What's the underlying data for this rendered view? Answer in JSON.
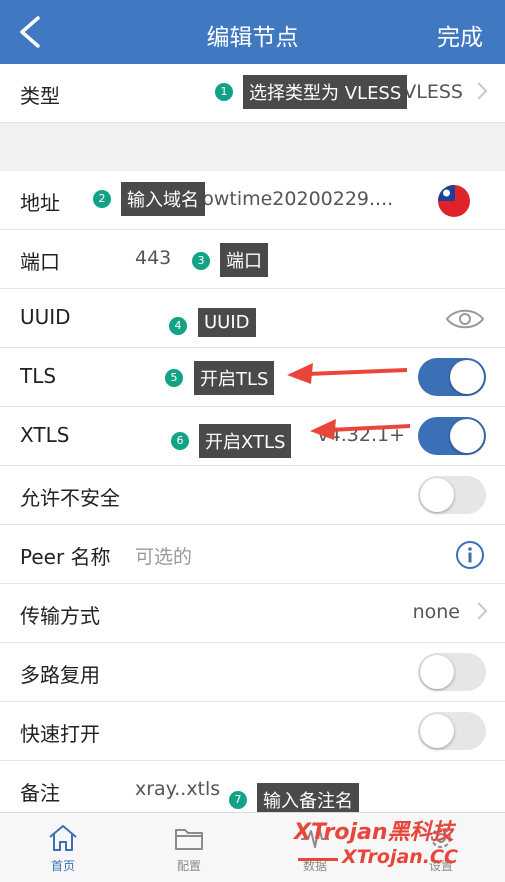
{
  "nav": {
    "title": "编辑节点",
    "done": "完成"
  },
  "rows": {
    "type": {
      "label": "类型",
      "value": "VLESS"
    },
    "address": {
      "label": "地址",
      "value": "xray.showtime20200229...."
    },
    "port": {
      "label": "端口",
      "value": "443"
    },
    "uuid": {
      "label": "UUID"
    },
    "tls": {
      "label": "TLS",
      "on": true
    },
    "xtls": {
      "label": "XTLS",
      "value": "v4.32.1+",
      "on": true
    },
    "insecure": {
      "label": "允许不安全",
      "on": false
    },
    "peer": {
      "label": "Peer 名称",
      "placeholder": "可选的"
    },
    "transport": {
      "label": "传输方式",
      "value": "none"
    },
    "mux": {
      "label": "多路复用",
      "on": false
    },
    "fastopen": {
      "label": "快速打开",
      "on": false
    },
    "remark": {
      "label": "备注",
      "value": "xray..xtls"
    }
  },
  "annotations": [
    {
      "num": "1",
      "text": "选择类型为 VLESS"
    },
    {
      "num": "2",
      "text": "输入域名"
    },
    {
      "num": "3",
      "text": "端口"
    },
    {
      "num": "4",
      "text": "UUID"
    },
    {
      "num": "5",
      "text": "开启TLS"
    },
    {
      "num": "6",
      "text": "开启XTLS"
    },
    {
      "num": "7",
      "text": "输入备注名"
    }
  ],
  "tabs": [
    {
      "label": "首页",
      "icon": "home-icon",
      "active": true
    },
    {
      "label": "配置",
      "icon": "folder-icon",
      "active": false
    },
    {
      "label": "数据",
      "icon": "pulse-icon",
      "active": false
    },
    {
      "label": "设置",
      "icon": "gear-icon",
      "active": false
    }
  ],
  "watermark": {
    "line1": "XTrojan黑科技",
    "line2": "XTrojan.CC"
  },
  "colors": {
    "accent": "#4178c2",
    "toggle_on": "#3b6fb6",
    "badge": "#12a387",
    "arrow": "#e8463b"
  }
}
